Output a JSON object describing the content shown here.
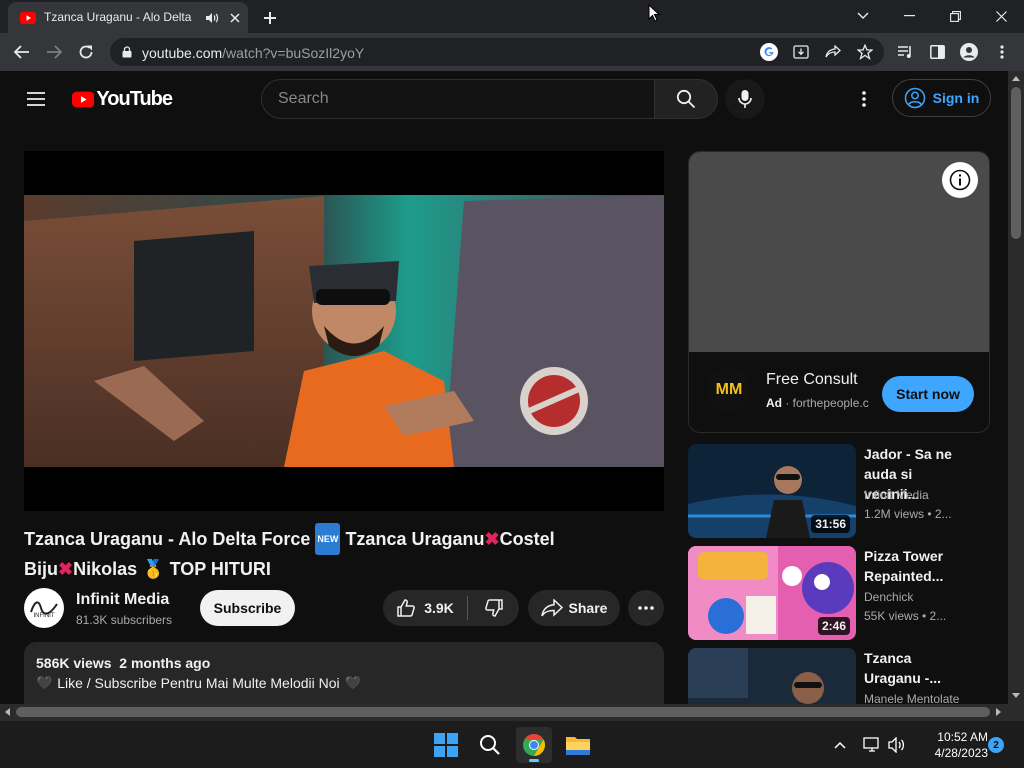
{
  "browser": {
    "tab_title": "Tzanca Uraganu - Alo Delta F",
    "url_domain": "youtube.com",
    "url_path": "/watch?v=buSozIl2yoY"
  },
  "youtube": {
    "logo_text": "YouTube",
    "search_placeholder": "Search",
    "signin_label": "Sign in"
  },
  "video": {
    "title_part1": "Tzanca Uraganu - Alo Delta Force",
    "new_badge": "NEW",
    "title_part2": "Tzanca Uraganu",
    "title_part3": "Costel Biju",
    "title_part4": "Nikolas",
    "title_part5": "TOP HITURI"
  },
  "channel": {
    "name": "Infinit Media",
    "subscribers": "81.3K subscribers",
    "subscribe_label": "Subscribe"
  },
  "actions": {
    "likes": "3.9K",
    "share_label": "Share"
  },
  "description": {
    "views": "586K views",
    "age": "2 months ago",
    "text": "Like / Subscribe Pentru Mai Multe Melodii Noi"
  },
  "ad": {
    "logo_text": "MM",
    "title": "Free Consult",
    "badge": "Ad",
    "domain": "forthepeople.c",
    "cta": "Start now"
  },
  "recommendations": [
    {
      "title": "Jador - Sa ne auda si vecinii...",
      "channel": "Infinit Media",
      "meta": "1.2M views  • 2...",
      "duration": "31:56"
    },
    {
      "title": "Pizza Tower Repainted...",
      "channel": "Denchick",
      "meta": "55K views  • 2...",
      "duration": "2:46"
    },
    {
      "title": "Tzanca Uraganu -...",
      "channel": "Manele Mentolate",
      "meta": "",
      "duration": ""
    }
  ],
  "taskbar": {
    "time": "10:52 AM",
    "date": "4/28/2023",
    "notification_count": "2"
  },
  "colors": {
    "yt_red": "#ff0000",
    "link_blue": "#3ea6ff",
    "bg": "#0f0f0f"
  }
}
